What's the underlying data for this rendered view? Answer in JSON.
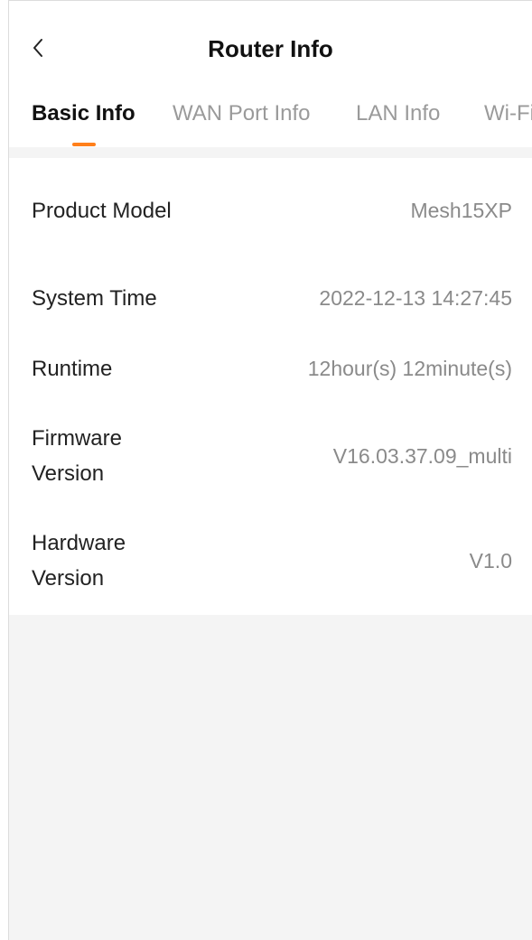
{
  "header": {
    "back_icon": "chevron-left-icon",
    "title": "Router Info"
  },
  "tabs": [
    {
      "label": "Basic Info",
      "active": true
    },
    {
      "label": "WAN Port Info",
      "active": false
    },
    {
      "label": "LAN Info",
      "active": false
    },
    {
      "label": "Wi-Fi",
      "active": false
    }
  ],
  "basic_info": [
    {
      "label": "Product Model",
      "value": "Mesh15XP"
    },
    {
      "label": "System Time",
      "value": "2022-12-13 14:27:45"
    },
    {
      "label": "Runtime",
      "value": "12hour(s) 12minute(s)"
    },
    {
      "label": "Firmware Version",
      "value": "V16.03.37.09_multi"
    },
    {
      "label": "Hardware Version",
      "value": "V1.0"
    }
  ],
  "colors": {
    "accent": "#ff7f1a",
    "background": "#f4f4f4",
    "text_primary": "#111111",
    "text_secondary": "#8a8a8a"
  }
}
